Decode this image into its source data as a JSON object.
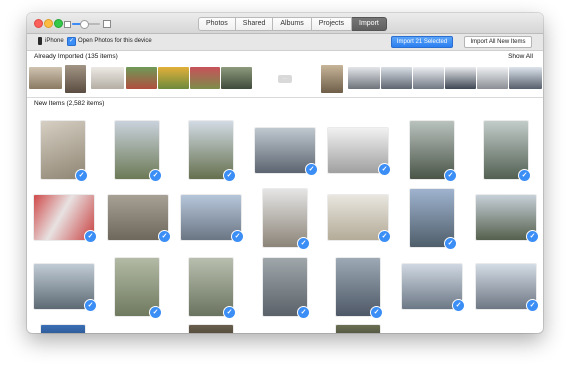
{
  "window": {
    "tabs": [
      "Photos",
      "Shared",
      "Albums",
      "Projects",
      "Import"
    ],
    "active_tab": "Import"
  },
  "import_bar": {
    "device_name": "iPhone",
    "open_photos_label": "Open Photos for this device",
    "open_photos_checked": true,
    "import_selected_label": "Import 21 Selected",
    "import_all_label": "Import All New Items"
  },
  "already_imported": {
    "header": "Already Imported (135 items)",
    "show_all_label": "Show All"
  },
  "new_items": {
    "header": "New Items (2,582 items)"
  },
  "colors": {
    "accent": "#3b8ef5",
    "active_tab": "#6a6a6a",
    "section_divider": "#d9d9d9"
  }
}
